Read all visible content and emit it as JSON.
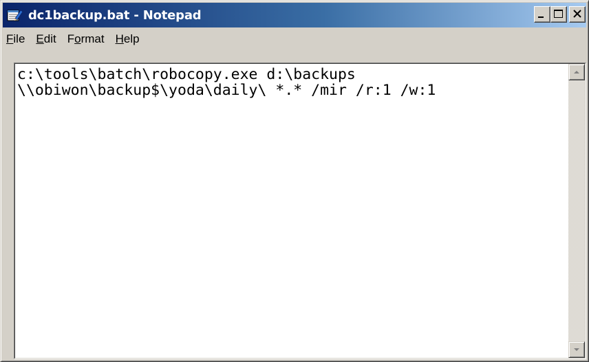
{
  "window": {
    "title": "dc1backup.bat - Notepad",
    "icon": "notepad-icon"
  },
  "title_buttons": {
    "minimize": "minimize-icon",
    "maximize": "maximize-icon",
    "close": "close-icon"
  },
  "menu": {
    "items": [
      {
        "accel": "F",
        "rest": "ile",
        "prefix": ""
      },
      {
        "accel": "E",
        "rest": "dit",
        "prefix": ""
      },
      {
        "accel": "o",
        "rest": "rmat",
        "prefix": "F"
      },
      {
        "accel": "H",
        "rest": "elp",
        "prefix": ""
      }
    ]
  },
  "editor": {
    "lines": [
      "c:\\tools\\batch\\robocopy.exe d:\\backups",
      "\\\\obiwon\\backup$\\yoda\\daily\\ *.* /mir /r:1 /w:1"
    ]
  },
  "scrollbar": {
    "up": "scroll-up-arrow-icon",
    "down": "scroll-down-arrow-icon"
  },
  "colors": {
    "title_active_start": "#0a246a",
    "title_active_end": "#a6caf0",
    "face": "#d4d0c8"
  }
}
